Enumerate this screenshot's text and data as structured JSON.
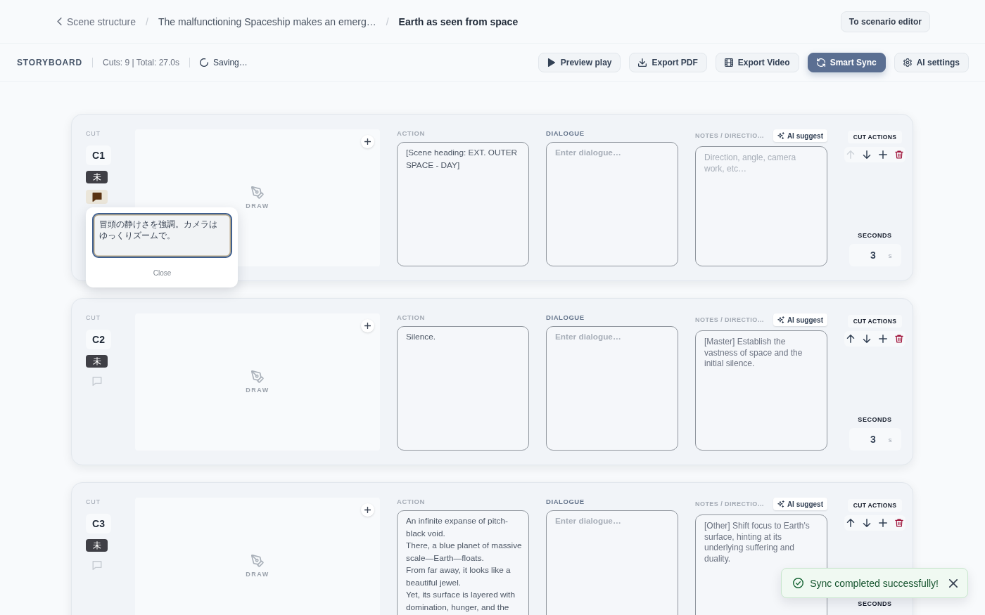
{
  "breadcrumb": [
    {
      "kind": "back",
      "label": "Scene structure",
      "current": false
    },
    {
      "separator": "/",
      "kind": "link",
      "label": "The malfunctioning Spaceship makes an emerg…",
      "current": false
    },
    {
      "separator": "/",
      "kind": "link",
      "label": "Earth as seen from space",
      "current": true
    }
  ],
  "editor_button": "To scenario editor",
  "toolbar": {
    "title": "STORYBOARD",
    "summary": "Cuts: 9 | Total: 27.0s",
    "status": "Saving…",
    "buttons": [
      {
        "kind": "preview",
        "label": "Preview play",
        "primary": false
      },
      {
        "kind": "pdf",
        "label": "Export PDF",
        "primary": false
      },
      {
        "kind": "video",
        "label": "Export Video",
        "primary": false
      },
      {
        "kind": "sync",
        "label": "Smart Sync",
        "primary": true
      },
      {
        "kind": "settings",
        "label": "AI settings",
        "primary": false
      }
    ]
  },
  "cuts": [
    {
      "cut_label": "CUT",
      "number": "C1",
      "status": "未",
      "note_marked": true,
      "note_popover": {
        "text": "冒頭の静けさを強調。カメラはゆっくりズームで。",
        "close": "Close"
      },
      "draw_label": "DRAW",
      "fields": [
        {
          "kind": "action",
          "label": "ACTION",
          "value": "[Scene heading: EXT. OUTER SPACE - DAY]"
        },
        {
          "kind": "dialogue",
          "label": "DIALOGUE",
          "placeholder": "Enter dialogue…"
        },
        {
          "kind": "notes",
          "label": "NOTES / DIRECTIO…",
          "suggest": "AI suggest",
          "placeholder": "Direction, angle, camera work, etc…"
        }
      ],
      "actions_label": "CUT ACTIONS",
      "up_disabled": true,
      "seconds_label": "SECONDS",
      "seconds": "3",
      "seconds_unit": "s"
    },
    {
      "cut_label": "CUT",
      "number": "C2",
      "status": "未",
      "note_marked": false,
      "draw_label": "DRAW",
      "fields": [
        {
          "kind": "action",
          "label": "ACTION",
          "value": "Silence."
        },
        {
          "kind": "dialogue",
          "label": "DIALOGUE",
          "placeholder": "Enter dialogue…"
        },
        {
          "kind": "notes",
          "label": "NOTES / DIRECTIO…",
          "suggest": "AI suggest",
          "value": "[Master] Establish the vastness of space and the initial silence."
        }
      ],
      "actions_label": "CUT ACTIONS",
      "up_disabled": false,
      "seconds_label": "SECONDS",
      "seconds": "3",
      "seconds_unit": "s"
    },
    {
      "cut_label": "CUT",
      "number": "C3",
      "status": "未",
      "note_marked": false,
      "draw_label": "DRAW",
      "fields": [
        {
          "kind": "action",
          "label": "ACTION",
          "value": "An infinite expanse of pitch-black void.\nThere, a blue planet of massive scale—Earth—floats.\nFrom far away, it looks like a beautiful jewel.\nYet, its surface is layered with domination, hunger, and the"
        },
        {
          "kind": "dialogue",
          "label": "DIALOGUE",
          "placeholder": "Enter dialogue…"
        },
        {
          "kind": "notes",
          "label": "NOTES / DIRECTIO…",
          "suggest": "AI suggest",
          "value": "[Other] Shift focus to Earth's surface, hinting at its underlying suffering and duality."
        }
      ],
      "actions_label": "CUT ACTIONS",
      "up_disabled": false,
      "seconds_label": "SECONDS"
    }
  ],
  "toast": {
    "message": "Sync completed successfully!"
  }
}
